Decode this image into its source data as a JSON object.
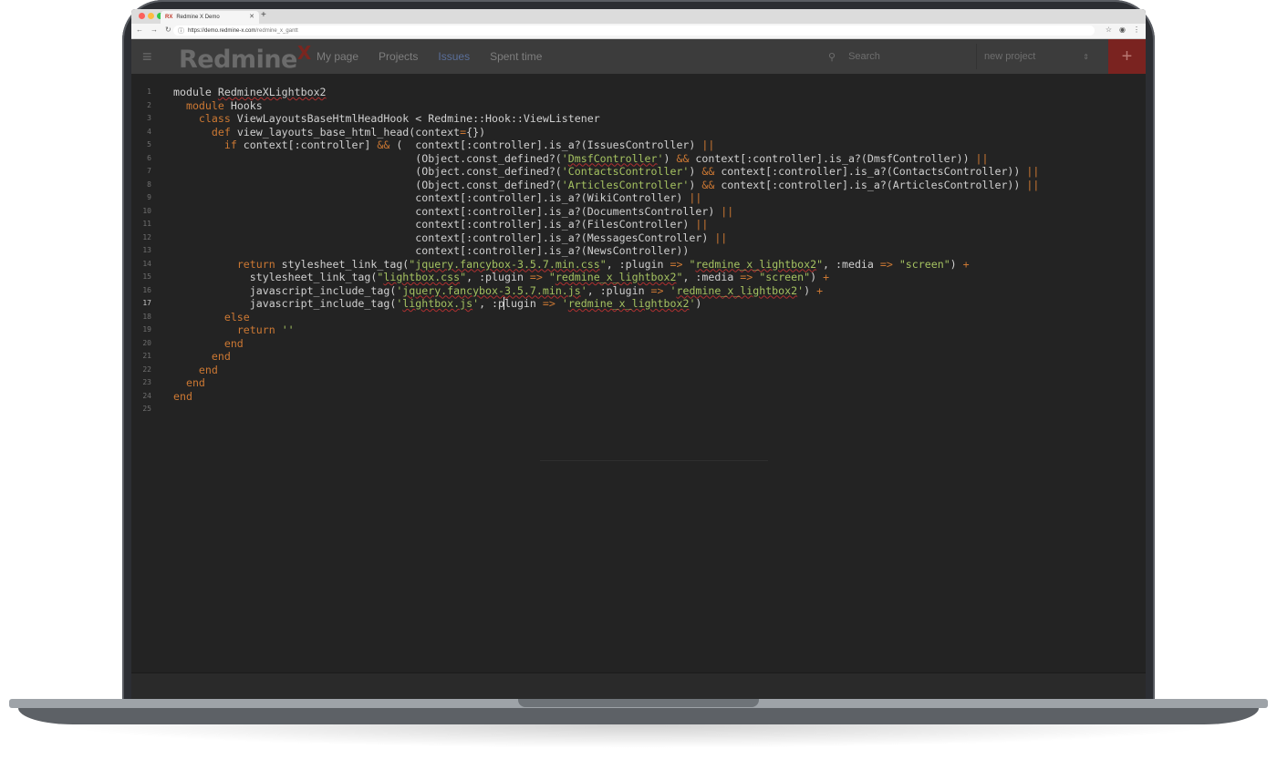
{
  "browser": {
    "tab_title": "Redmine X Demo",
    "favicon_text": "RX",
    "url_host": "https://demo.redmine-x.com",
    "url_path": "/redmine_x_gantt"
  },
  "app": {
    "logo_text": "Redmine",
    "logo_sup": "X",
    "nav": [
      {
        "label": "My page",
        "active": false
      },
      {
        "label": "Projects",
        "active": false
      },
      {
        "label": "Issues",
        "active": true
      },
      {
        "label": "Spent time",
        "active": false
      }
    ],
    "search_placeholder": "Search",
    "project_select": "new project",
    "add_button": "+"
  },
  "editor": {
    "current_line": 17,
    "lines": [
      [
        [
          "t",
          "module "
        ],
        [
          "u",
          "RedmineXLightbox2"
        ]
      ],
      [
        [
          "t",
          "  "
        ],
        [
          "k",
          "module"
        ],
        [
          "t",
          " Hooks"
        ]
      ],
      [
        [
          "t",
          "    "
        ],
        [
          "k",
          "class"
        ],
        [
          "t",
          " ViewLayoutsBaseHtmlHeadHook < Redmine::Hook::ViewListener"
        ]
      ],
      [
        [
          "t",
          "      "
        ],
        [
          "k",
          "def"
        ],
        [
          "t",
          " view_layouts_base_html_head(context"
        ],
        [
          "k",
          "="
        ],
        [
          "t",
          "{})"
        ]
      ],
      [
        [
          "t",
          "        "
        ],
        [
          "k",
          "if"
        ],
        [
          "t",
          " context[:controller] "
        ],
        [
          "k",
          "&&"
        ],
        [
          "t",
          " (  context[:controller].is_a?(IssuesController) "
        ],
        [
          "k",
          "||"
        ]
      ],
      [
        [
          "t",
          "                                      (Object.const_defined?("
        ],
        [
          "s",
          "'"
        ],
        [
          "su",
          "DmsfController"
        ],
        [
          "s",
          "'"
        ],
        [
          "t",
          ") "
        ],
        [
          "k",
          "&&"
        ],
        [
          "t",
          " context[:controller].is_a?(DmsfController)) "
        ],
        [
          "k",
          "||"
        ]
      ],
      [
        [
          "t",
          "                                      (Object.const_defined?("
        ],
        [
          "s",
          "'ContactsController'"
        ],
        [
          "t",
          ") "
        ],
        [
          "k",
          "&&"
        ],
        [
          "t",
          " context[:controller].is_a?(ContactsController)) "
        ],
        [
          "k",
          "||"
        ]
      ],
      [
        [
          "t",
          "                                      (Object.const_defined?("
        ],
        [
          "s",
          "'ArticlesController'"
        ],
        [
          "t",
          ") "
        ],
        [
          "k",
          "&&"
        ],
        [
          "t",
          " context[:controller].is_a?(ArticlesController)) "
        ],
        [
          "k",
          "||"
        ]
      ],
      [
        [
          "t",
          "                                      context[:controller].is_a?(WikiController) "
        ],
        [
          "k",
          "||"
        ]
      ],
      [
        [
          "t",
          "                                      context[:controller].is_a?(DocumentsController) "
        ],
        [
          "k",
          "||"
        ]
      ],
      [
        [
          "t",
          "                                      context[:controller].is_a?(FilesController) "
        ],
        [
          "k",
          "||"
        ]
      ],
      [
        [
          "t",
          "                                      context[:controller].is_a?(MessagesController) "
        ],
        [
          "k",
          "||"
        ]
      ],
      [
        [
          "t",
          "                                      context[:controller].is_a?(NewsController))"
        ]
      ],
      [
        [
          "t",
          "          "
        ],
        [
          "k",
          "return"
        ],
        [
          "t",
          " stylesheet_link_tag("
        ],
        [
          "s",
          "\""
        ],
        [
          "su",
          "jquery.fancybox-3.5.7.min.css"
        ],
        [
          "s",
          "\""
        ],
        [
          "t",
          ", :plugin "
        ],
        [
          "k",
          "=>"
        ],
        [
          "t",
          " "
        ],
        [
          "s",
          "\""
        ],
        [
          "su",
          "redmine_x_lightbox2"
        ],
        [
          "s",
          "\""
        ],
        [
          "t",
          ", :media "
        ],
        [
          "k",
          "=>"
        ],
        [
          "t",
          " "
        ],
        [
          "s",
          "\"screen\""
        ],
        [
          "t",
          ") "
        ],
        [
          "k",
          "+"
        ]
      ],
      [
        [
          "t",
          "            stylesheet_link_tag("
        ],
        [
          "s",
          "\""
        ],
        [
          "su",
          "lightbox.css"
        ],
        [
          "s",
          "\""
        ],
        [
          "t",
          ", :plugin "
        ],
        [
          "k",
          "=>"
        ],
        [
          "t",
          " "
        ],
        [
          "s",
          "\""
        ],
        [
          "su",
          "redmine_x_lightbox2"
        ],
        [
          "s",
          "\""
        ],
        [
          "t",
          ", :media "
        ],
        [
          "k",
          "=>"
        ],
        [
          "t",
          " "
        ],
        [
          "s",
          "\"screen\""
        ],
        [
          "t",
          ") "
        ],
        [
          "k",
          "+"
        ]
      ],
      [
        [
          "t",
          "            javascript_include_tag("
        ],
        [
          "s",
          "'"
        ],
        [
          "su",
          "jquery.fancybox-3.5.7.min.js"
        ],
        [
          "s",
          "'"
        ],
        [
          "t",
          ", :plugin "
        ],
        [
          "k",
          "=>"
        ],
        [
          "t",
          " "
        ],
        [
          "s",
          "'"
        ],
        [
          "su",
          "redmine_x_lightbox2"
        ],
        [
          "s",
          "'"
        ],
        [
          "t",
          ") "
        ],
        [
          "k",
          "+"
        ]
      ],
      [
        [
          "t",
          "            javascript_include_tag("
        ],
        [
          "s",
          "'"
        ],
        [
          "su",
          "lightbox.js"
        ],
        [
          "s",
          "'"
        ],
        [
          "t",
          ", :p"
        ],
        [
          "c",
          ""
        ],
        [
          "t",
          "lugin "
        ],
        [
          "k",
          "=>"
        ],
        [
          "t",
          " "
        ],
        [
          "s",
          "'"
        ],
        [
          "su",
          "redmine_x_lightbox2"
        ],
        [
          "s",
          "'"
        ],
        [
          "t",
          ")"
        ]
      ],
      [
        [
          "t",
          "        "
        ],
        [
          "k",
          "else"
        ]
      ],
      [
        [
          "t",
          "          "
        ],
        [
          "k",
          "return"
        ],
        [
          "t",
          " "
        ],
        [
          "s",
          "''"
        ]
      ],
      [
        [
          "t",
          "        "
        ],
        [
          "k",
          "end"
        ]
      ],
      [
        [
          "t",
          "      "
        ],
        [
          "k",
          "end"
        ]
      ],
      [
        [
          "t",
          "    "
        ],
        [
          "k",
          "end"
        ]
      ],
      [
        [
          "t",
          "  "
        ],
        [
          "k",
          "end"
        ]
      ],
      [
        [
          "k",
          "end"
        ]
      ],
      [
        [
          "t",
          ""
        ]
      ]
    ]
  }
}
